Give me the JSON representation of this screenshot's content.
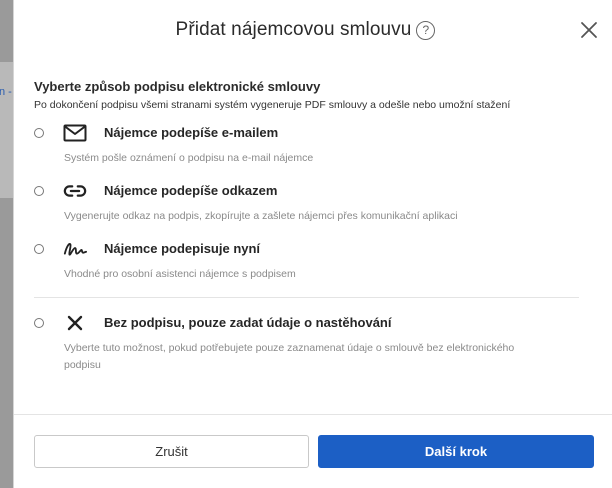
{
  "background": {
    "link_fragment": "n -"
  },
  "modal": {
    "title": "Přidat nájemcovou smlouvu",
    "help_glyph": "?",
    "instruction_title": "Vyberte způsob podpisu elektronické smlouvy",
    "instruction_subtitle": "Po dokončení podpisu všemi stranami systém vygeneruje PDF smlouvy a odešle nebo umožní stažení",
    "options": [
      {
        "icon": "envelope-icon",
        "label": "Nájemce podepíše e-mailem",
        "description": "Systém pošle oznámení o podpisu na e-mail nájemce",
        "selected": false
      },
      {
        "icon": "link-icon",
        "label": "Nájemce podepíše odkazem",
        "description": "Vygenerujte odkaz na podpis, zkopírujte a zašlete nájemci přes komunikační aplikaci",
        "selected": false
      },
      {
        "icon": "signature-icon",
        "label": "Nájemce podepisuje nyní",
        "description": "Vhodné pro osobní asistenci nájemce s podpisem",
        "selected": false
      },
      {
        "icon": "x-icon",
        "label": "Bez podpisu, pouze zadat údaje o nastěhování",
        "description": "Vyberte tuto možnost, pokud potřebujete pouze zaznamenat údaje o smlouvě bez elektronického podpisu",
        "selected": false
      }
    ],
    "cancel_label": "Zrušit",
    "next_label": "Další krok"
  },
  "colors": {
    "primary": "#1c5fc5",
    "muted_text": "#8a8a8a",
    "overlay": "#8e8e8e"
  }
}
